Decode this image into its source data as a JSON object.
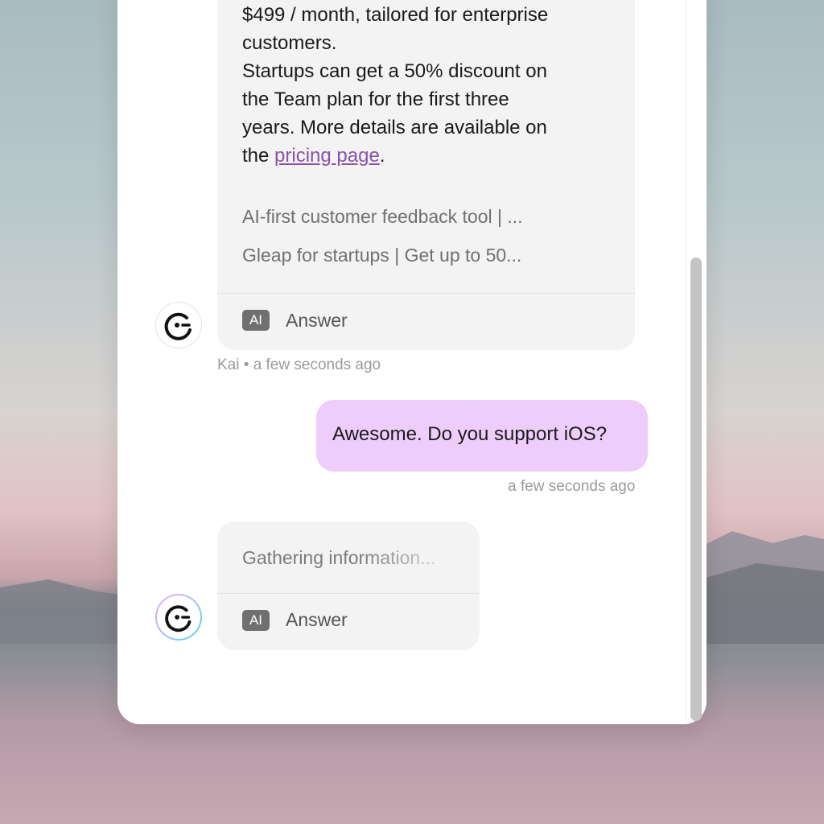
{
  "message1": {
    "lines": [
      "$499 / month, tailored for enterprise",
      "customers.",
      "Startups can get a 50% discount on",
      "the Team plan for the first three",
      "years. More details are available on"
    ],
    "last_prefix": "the ",
    "link_text": "pricing page",
    "last_suffix": ".",
    "sources": [
      "AI-first customer feedback tool | ...",
      "Gleap for startups | Get up to 50..."
    ],
    "badge": "AI",
    "footer_label": "Answer",
    "meta_author": "Kai",
    "meta_sep": "•",
    "meta_time": "a few seconds ago"
  },
  "user_message": {
    "text": "Awesome. Do you support iOS?",
    "time": "a few seconds ago"
  },
  "message2": {
    "loading_text": "Gathering information...",
    "badge": "AI",
    "footer_label": "Answer"
  },
  "colors": {
    "user_bubble": "#efcdfb",
    "link": "#8a52a8",
    "bot_bubble": "#f3f3f3"
  },
  "icons": {
    "avatar": "wink-face-icon"
  }
}
